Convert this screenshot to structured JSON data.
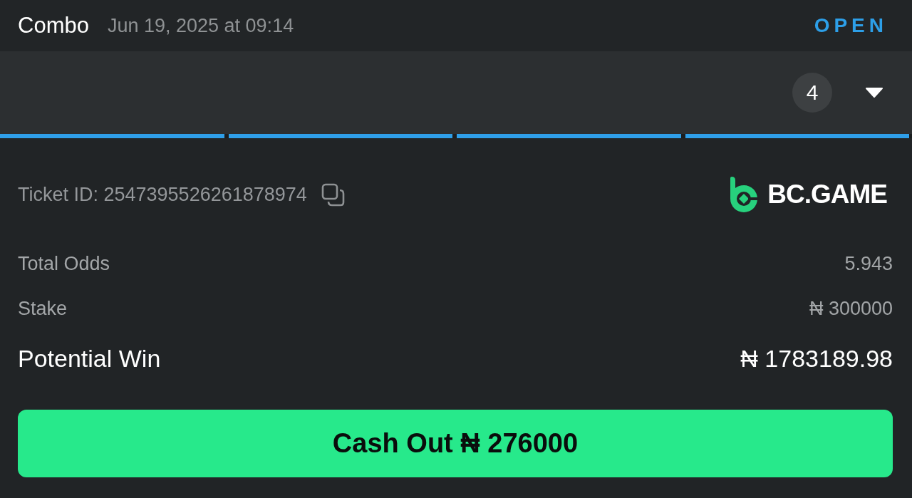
{
  "header": {
    "title": "Combo",
    "date": "Jun 19, 2025 at 09:14",
    "status": "OPEN"
  },
  "legs_panel": {
    "count": "4",
    "expanded": false,
    "segments": [
      {
        "color": "#2f9fe9"
      },
      {
        "color": "#2f9fe9"
      },
      {
        "color": "#2f9fe9"
      },
      {
        "color": "#2f9fe9"
      }
    ]
  },
  "ticket": {
    "label": "Ticket ID: 2547395526261878974",
    "brand": "BC.GAME"
  },
  "summary": [
    {
      "kind": "normal",
      "label": "Total Odds",
      "value": "5.943"
    },
    {
      "kind": "normal",
      "label": "Stake",
      "value": "₦ 300000"
    },
    {
      "kind": "emphasis",
      "label": "Potential Win",
      "value": "₦ 1783189.98"
    }
  ],
  "cash_out_button": "Cash Out ₦ 276000"
}
